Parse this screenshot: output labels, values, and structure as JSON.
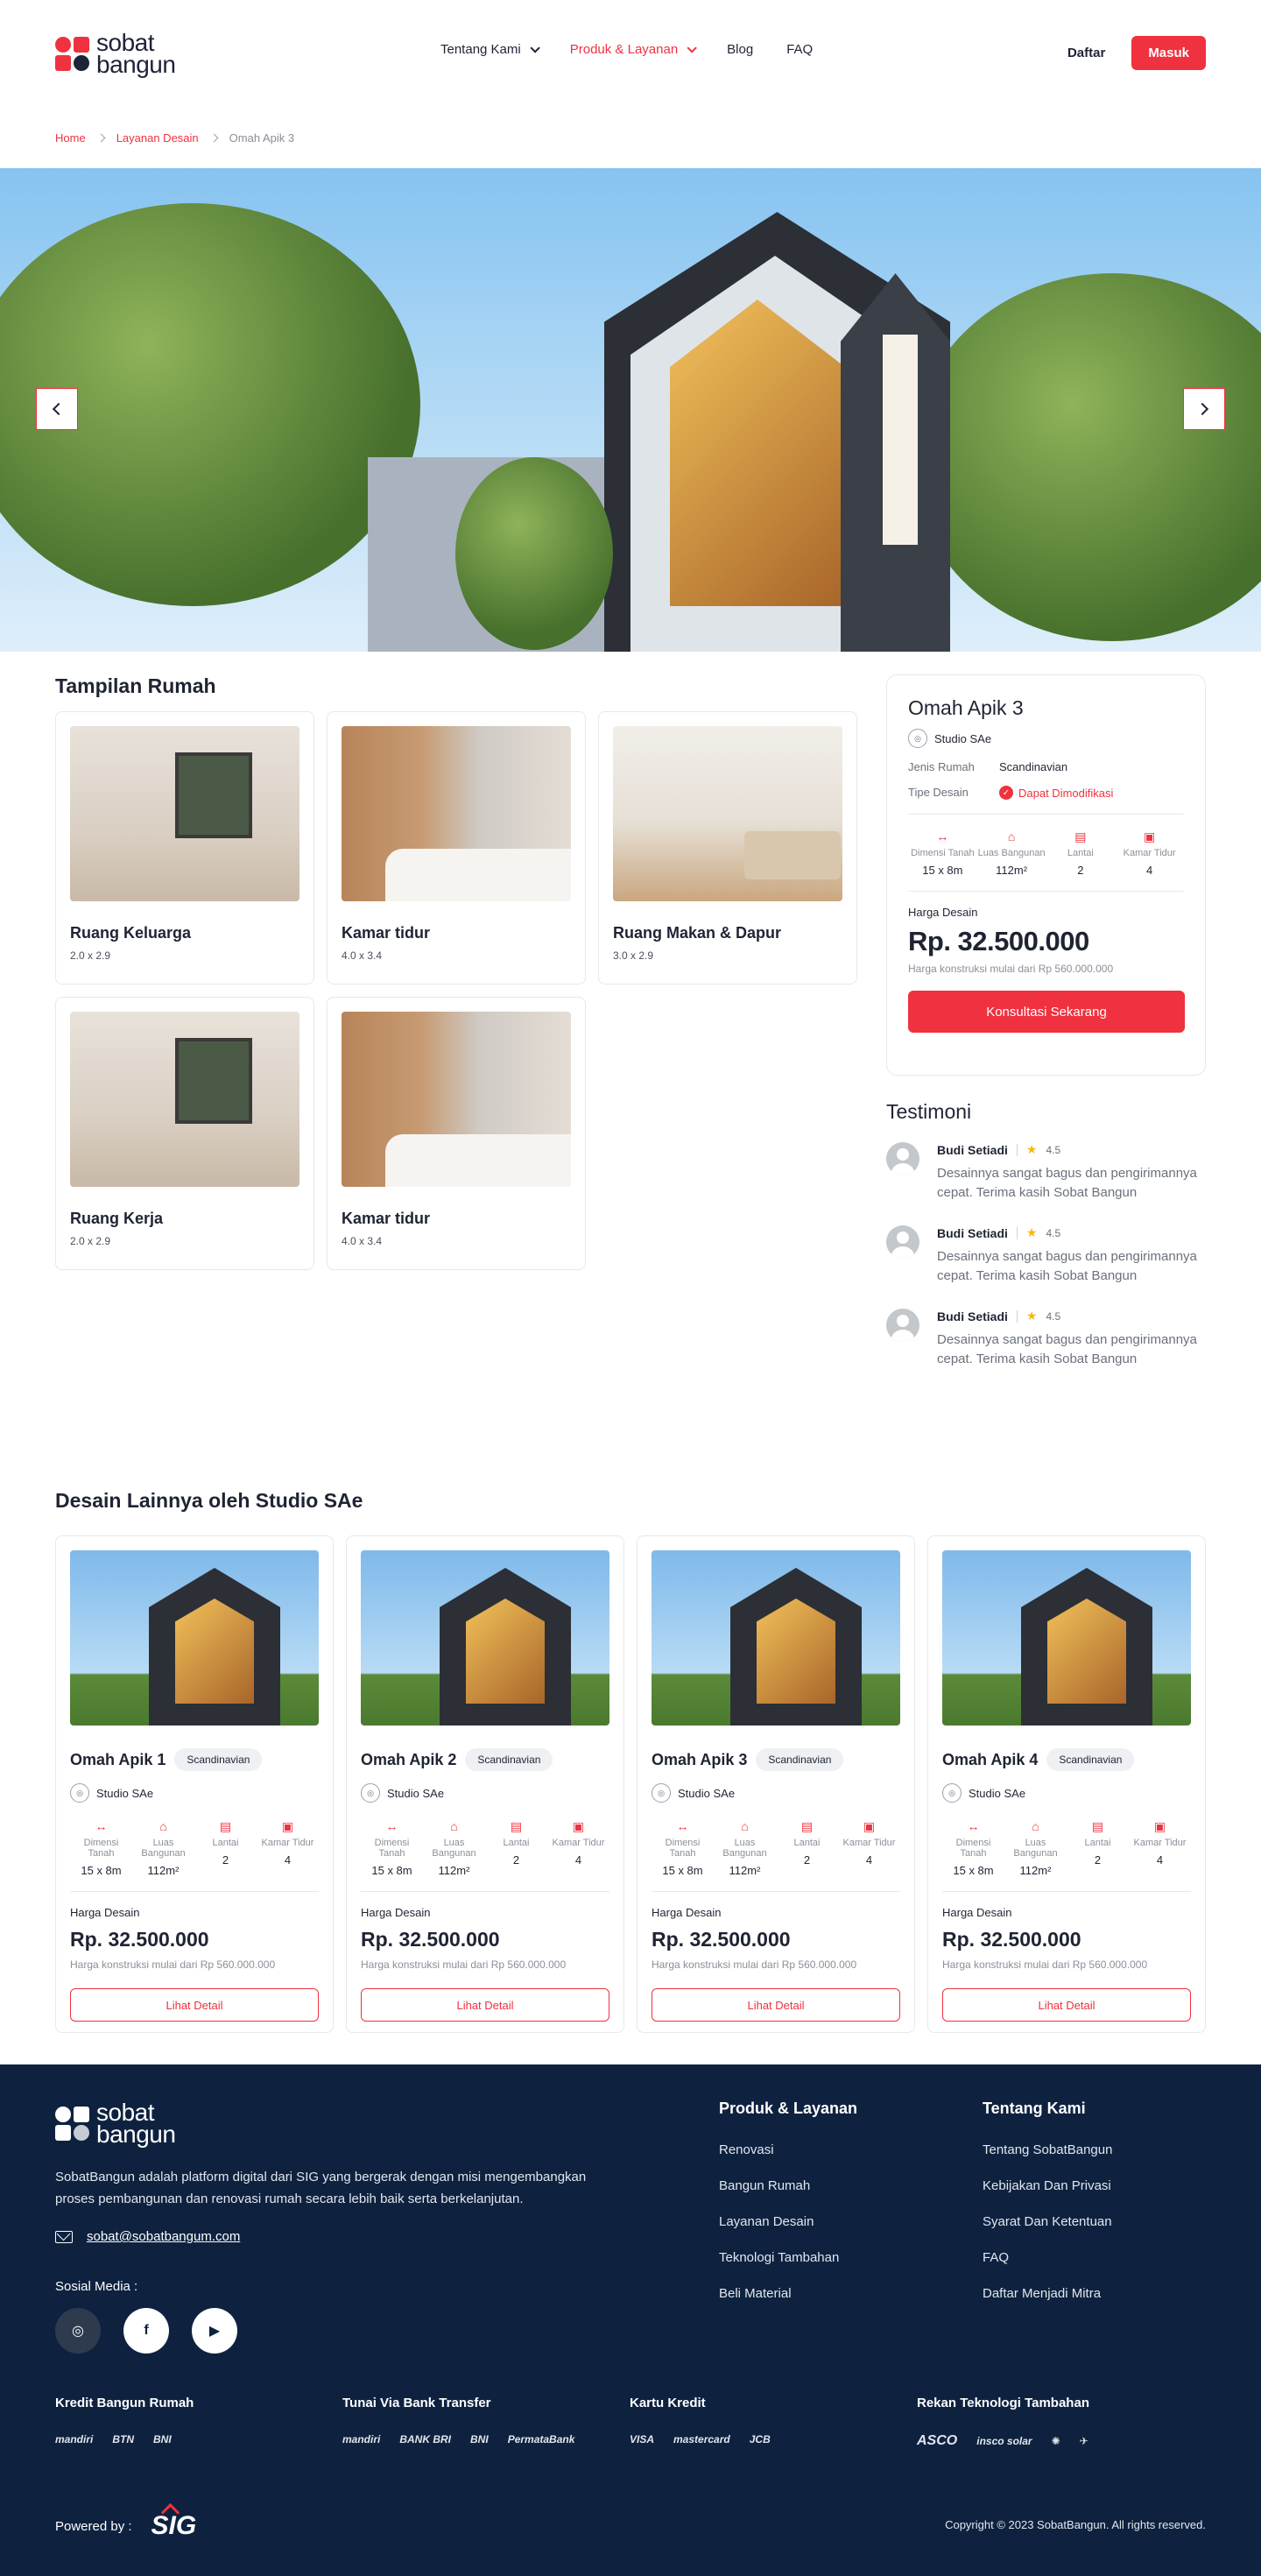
{
  "header": {
    "logo_line1": "sobat",
    "logo_line2": "bangun",
    "nav": [
      {
        "label": "Tentang Kami"
      },
      {
        "label": "Produk & Layanan"
      },
      {
        "label": "Blog"
      },
      {
        "label": "FAQ"
      }
    ],
    "daftar": "Daftar",
    "masuk": "Masuk",
    "accent_color": "#f0313f"
  },
  "breadcrumb": [
    "Home",
    "Layanan Desain",
    "Omah Apik 3"
  ],
  "rooms_title": "Tampilan Rumah",
  "rooms": [
    {
      "name": "Ruang Keluarga",
      "size": "2.0 x 2.9"
    },
    {
      "name": "Kamar tidur",
      "size": "4.0 x 3.4"
    },
    {
      "name": "Ruang Makan & Dapur",
      "size": "3.0 x 2.9"
    },
    {
      "name": "Ruang Kerja",
      "size": "2.0 x 2.9"
    },
    {
      "name": "Kamar tidur",
      "size": "4.0 x 3.4"
    }
  ],
  "info": {
    "title": "Omah Apik 3",
    "studio": "Studio SAe",
    "jenis_label": "Jenis Rumah",
    "jenis_value": "Scandinavian",
    "tipe_label": "Tipe Desain",
    "tipe_value": "Dapat Dimodifikasi",
    "specs": [
      {
        "label": "Dimensi Tanah",
        "value": "15 x 8m"
      },
      {
        "label": "Luas Bangunan",
        "value": "112m²"
      },
      {
        "label": "Lantai",
        "value": "2"
      },
      {
        "label": "Kamar Tidur",
        "value": "4"
      }
    ],
    "price_label": "Harga Desain",
    "price": "Rp. 32.500.000",
    "price_note": "Harga konstruksi mulai dari Rp 560.000.000",
    "cta": "Konsultasi Sekarang"
  },
  "testimoni": {
    "title": "Testimoni",
    "items": [
      {
        "name": "Budi Setiadi",
        "rating": "4.5",
        "text": "Desainnya sangat bagus dan pengirimannya cepat. Terima kasih Sobat Bangun"
      },
      {
        "name": "Budi Setiadi",
        "rating": "4.5",
        "text": "Desainnya sangat bagus dan pengirimannya cepat. Terima kasih Sobat Bangun"
      },
      {
        "name": "Budi Setiadi",
        "rating": "4.5",
        "text": "Desainnya sangat bagus dan pengirimannya cepat. Terima kasih Sobat Bangun"
      }
    ]
  },
  "other": {
    "title": "Desain Lainnya oleh Studio SAe",
    "items": [
      {
        "name": "Omah Apik 1",
        "tag": "Scandinavian",
        "studio": "Studio SAe"
      },
      {
        "name": "Omah Apik 2",
        "tag": "Scandinavian",
        "studio": "Studio SAe"
      },
      {
        "name": "Omah Apik 3",
        "tag": "Scandinavian",
        "studio": "Studio SAe"
      },
      {
        "name": "Omah Apik 4",
        "tag": "Scandinavian",
        "studio": "Studio SAe"
      }
    ],
    "specs": [
      {
        "label": "Dimensi Tanah",
        "value": "15 x 8m"
      },
      {
        "label": "Luas Bangunan",
        "value": "112m²"
      },
      {
        "label": "Lantai",
        "value": "2"
      },
      {
        "label": "Kamar Tidur",
        "value": "4"
      }
    ],
    "price_label": "Harga Desain",
    "price": "Rp. 32.500.000",
    "price_note": "Harga konstruksi mulai dari Rp 560.000.000",
    "button": "Lihat Detail"
  },
  "footer": {
    "logo_line1": "sobat",
    "logo_line2": "bangun",
    "description": "SobatBangun adalah platform digital dari SIG yang bergerak dengan misi mengembangkan proses pembangunan dan renovasi rumah secara lebih baik serta berkelanjutan.",
    "email": "sobat@sobatbangum.com",
    "social_label": "Sosial Media :",
    "col1_title": "Produk & Layanan",
    "col1": [
      "Renovasi",
      "Bangun Rumah",
      "Layanan Desain",
      "Teknologi Tambahan",
      "Beli Material"
    ],
    "col2_title": "Tentang Kami",
    "col2": [
      "Tentang SobatBangun",
      "Kebijakan Dan Privasi",
      "Syarat Dan Ketentuan",
      "FAQ",
      "Daftar Menjadi Mitra"
    ],
    "pay_groups": [
      {
        "title": "Kredit Bangun Rumah",
        "logos": [
          "mandiri",
          "BTN",
          "BNI"
        ]
      },
      {
        "title": "Tunai Via Bank Transfer",
        "logos": [
          "mandiri",
          "BANK BRI",
          "BNI",
          "PermataBank"
        ]
      },
      {
        "title": "Kartu Kredit",
        "logos": [
          "VISA",
          "mastercard",
          "JCB"
        ]
      },
      {
        "title": "Rekan Teknologi Tambahan",
        "logos": [
          "ASCO",
          "insco solar"
        ]
      }
    ],
    "powered": "Powered by :",
    "sig": "SIG",
    "copyright": "Copyright © 2023 SobatBangun. All rights reserved."
  }
}
